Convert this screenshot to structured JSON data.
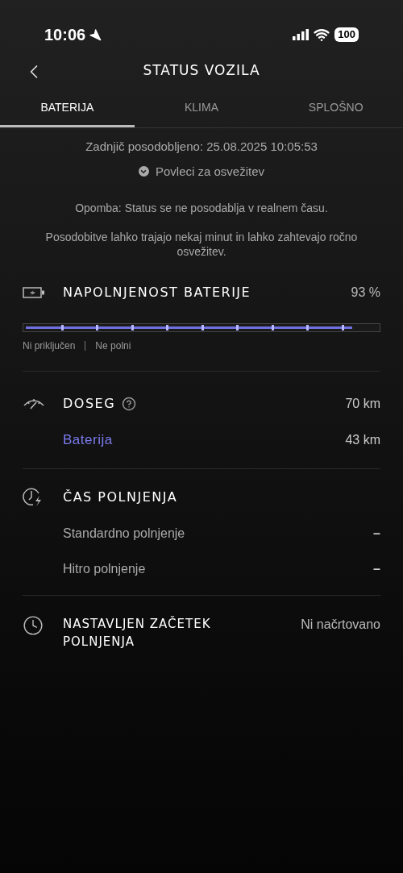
{
  "status_bar": {
    "time": "10:06",
    "battery": "100"
  },
  "header": {
    "title": "STATUS VOZILA"
  },
  "tabs": [
    {
      "label": "BATERIJA",
      "selected": true
    },
    {
      "label": "KLIMA",
      "selected": false
    },
    {
      "label": "SPLOŠNO",
      "selected": false
    }
  ],
  "info": {
    "updated": "Zadnjič posodobljeno: 25.08.2025 10:05:53",
    "pull": "Povleci za osvežitev",
    "note": "Opomba: Status se ne posodablja v realnem času.",
    "hint": "Posodobitve lahko trajajo nekaj minut in lahko zahtevajo ročno osvežitev."
  },
  "charge": {
    "title": "NAPOLNJENOST BATERIJE",
    "value": "93 %",
    "level": 0.93,
    "plug": "Ni priključen",
    "state": "Ne polni"
  },
  "range": {
    "title": "DOSEG",
    "value": "70 km",
    "sub_label": "Baterija",
    "sub_value": "43 km"
  },
  "charge_time": {
    "title": "ČAS POLNJENJA",
    "rows": [
      {
        "label": "Standardno polnjenje",
        "value": "–"
      },
      {
        "label": "Hitro polnjenje",
        "value": "–"
      }
    ]
  },
  "schedule": {
    "title": "NASTAVLJEN ZAČETEK POLNJENJA",
    "value": "Ni načrtovano"
  }
}
